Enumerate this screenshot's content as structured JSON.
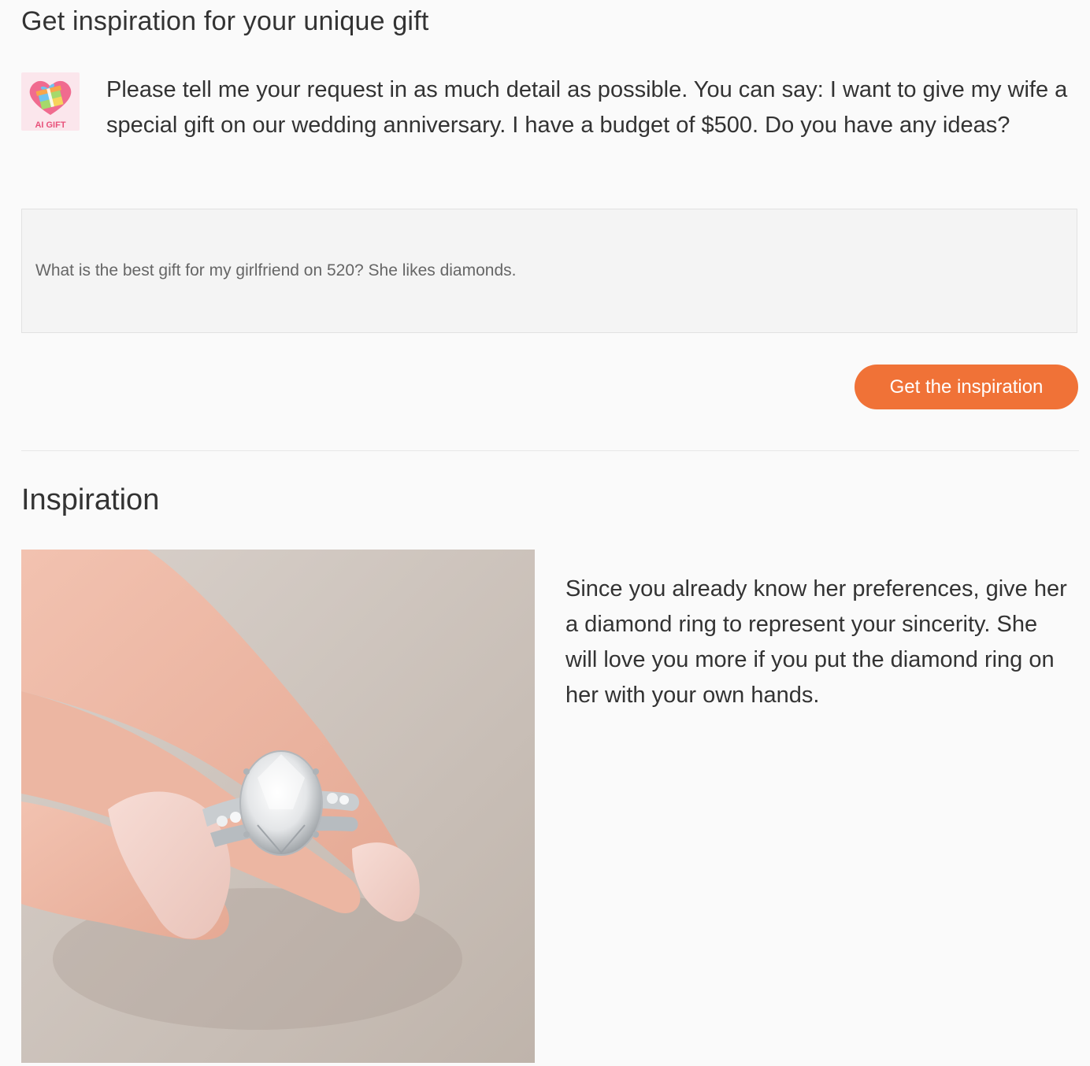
{
  "header": {
    "title": "Get inspiration for your unique gift"
  },
  "assistant": {
    "logo_text": "AI GIFT",
    "logo_icon": "gift-heart-icon",
    "intro": "Please tell me your request in as much detail as possible. You can say: I want to give my wife a special gift on our wedding anniversary. I have a budget of $500. Do you have any ideas?"
  },
  "prompt": {
    "value": "What is the best gift for my girlfriend on 520? She likes diamonds."
  },
  "actions": {
    "submit_label": "Get the inspiration"
  },
  "result": {
    "title": "Inspiration",
    "image_subject": "hand holding oval diamond engagement ring with band",
    "text": "Since you already know her preferences, give her a diamond ring to represent your sincerity. She will love you more if you put the diamond ring on her with your own hands."
  },
  "colors": {
    "accent": "#f07237",
    "logo_pink": "#f06b8f"
  }
}
